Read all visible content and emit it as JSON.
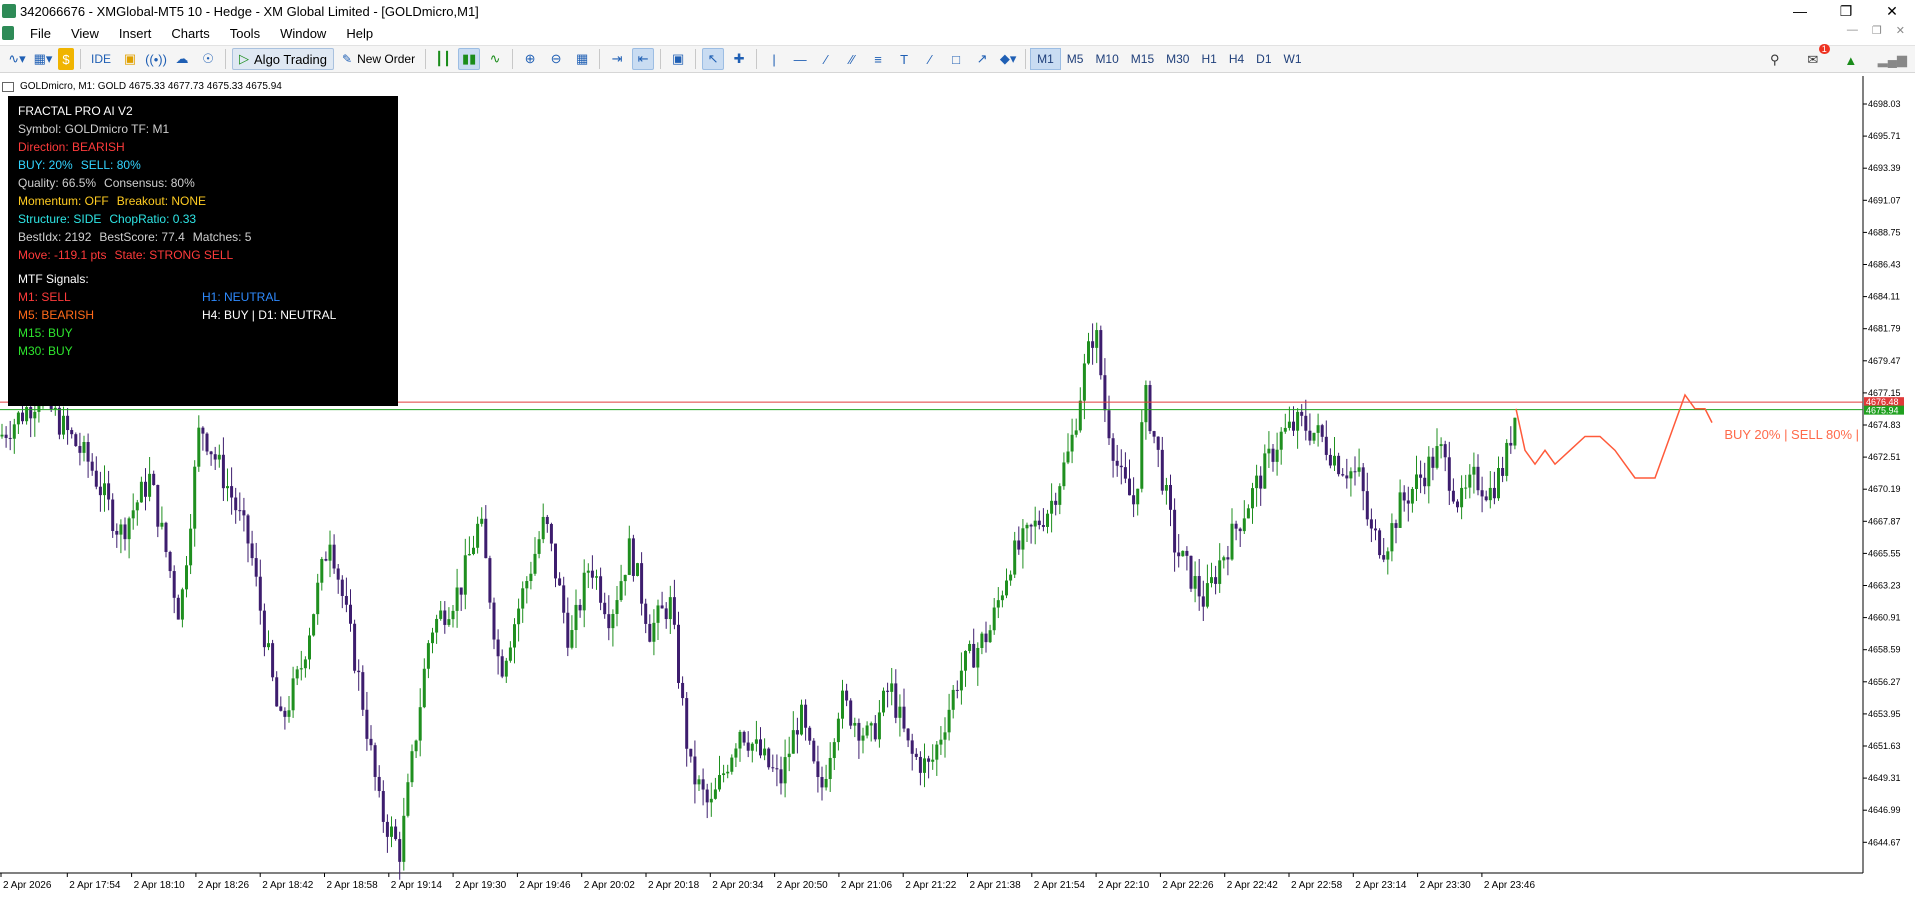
{
  "window": {
    "title": "342066676 - XMGlobal-MT5 10 - Hedge - XM Global Limited - [GOLDmicro,M1]"
  },
  "menu": [
    "File",
    "View",
    "Insert",
    "Charts",
    "Tools",
    "Window",
    "Help"
  ],
  "toolbar": {
    "ide_label": "IDE",
    "algo_label": "Algo Trading",
    "new_order_label": "New Order",
    "timeframes": [
      "M1",
      "M5",
      "M10",
      "M15",
      "M30",
      "H1",
      "H4",
      "D1",
      "W1"
    ],
    "selected_timeframe": "M1",
    "notification_count": "1"
  },
  "chart": {
    "symbol_line": "GOLDmicro, M1:  GOLD  4675.33 4677.73 4675.33 4675.94",
    "price_labels": [
      "4698.03",
      "4695.71",
      "4693.39",
      "4691.07",
      "4688.75",
      "4686.43",
      "4684.11",
      "4681.79",
      "4679.47",
      "4677.15",
      "4674.83",
      "4672.51",
      "4670.19",
      "4667.87",
      "4665.55",
      "4663.23",
      "4660.91",
      "4658.59",
      "4656.27",
      "4653.95",
      "4651.63",
      "4649.31",
      "4646.99",
      "4644.67"
    ],
    "ask_tag": "4676.48",
    "bid_tag": "4675.94",
    "time_labels": [
      "2 Apr 2026",
      "2 Apr 17:54",
      "2 Apr 18:10",
      "2 Apr 18:26",
      "2 Apr 18:42",
      "2 Apr 18:58",
      "2 Apr 19:14",
      "2 Apr 19:30",
      "2 Apr 19:46",
      "2 Apr 20:02",
      "2 Apr 20:18",
      "2 Apr 20:34",
      "2 Apr 20:50",
      "2 Apr 21:06",
      "2 Apr 21:22",
      "2 Apr 21:38",
      "2 Apr 21:54",
      "2 Apr 22:10",
      "2 Apr 22:26",
      "2 Apr 22:42",
      "2 Apr 22:58",
      "2 Apr 23:14",
      "2 Apr 23:30",
      "2 Apr 23:46"
    ],
    "projection_label": "BUY 20% | SELL 80% |",
    "colors": {
      "bull": "#1f8f1f",
      "bear": "#3d1d6e",
      "ask_line": "#e03a3a",
      "bid_line": "#1fa01f",
      "projection": "#ff5a3a"
    }
  },
  "panel": {
    "title": "FRACTAL PRO AI V2",
    "symbol": "Symbol: GOLDmicro TF: M1",
    "direction": "Direction: BEARISH",
    "buy": "BUY: 20%",
    "sell": "SELL: 80%",
    "quality": "Quality: 66.5%",
    "consensus": "Consensus: 80%",
    "momentum": "Momentum: OFF",
    "breakout": "Breakout: NONE",
    "structure": "Structure: SIDE",
    "chop": "ChopRatio: 0.33",
    "bestidx": "BestIdx: 2192",
    "bestscore": "BestScore: 77.4",
    "matches": "Matches: 5",
    "move": "Move: -119.1 pts",
    "state": "State: STRONG SELL",
    "mtf_title": "MTF Signals:",
    "m1": "M1: SELL",
    "m5": "M5: BEARISH",
    "m15": "M15: BUY",
    "m30": "M30: BUY",
    "h1": "H1: NEUTRAL",
    "h4d1": "H4: BUY   |   D1: NEUTRAL"
  }
}
